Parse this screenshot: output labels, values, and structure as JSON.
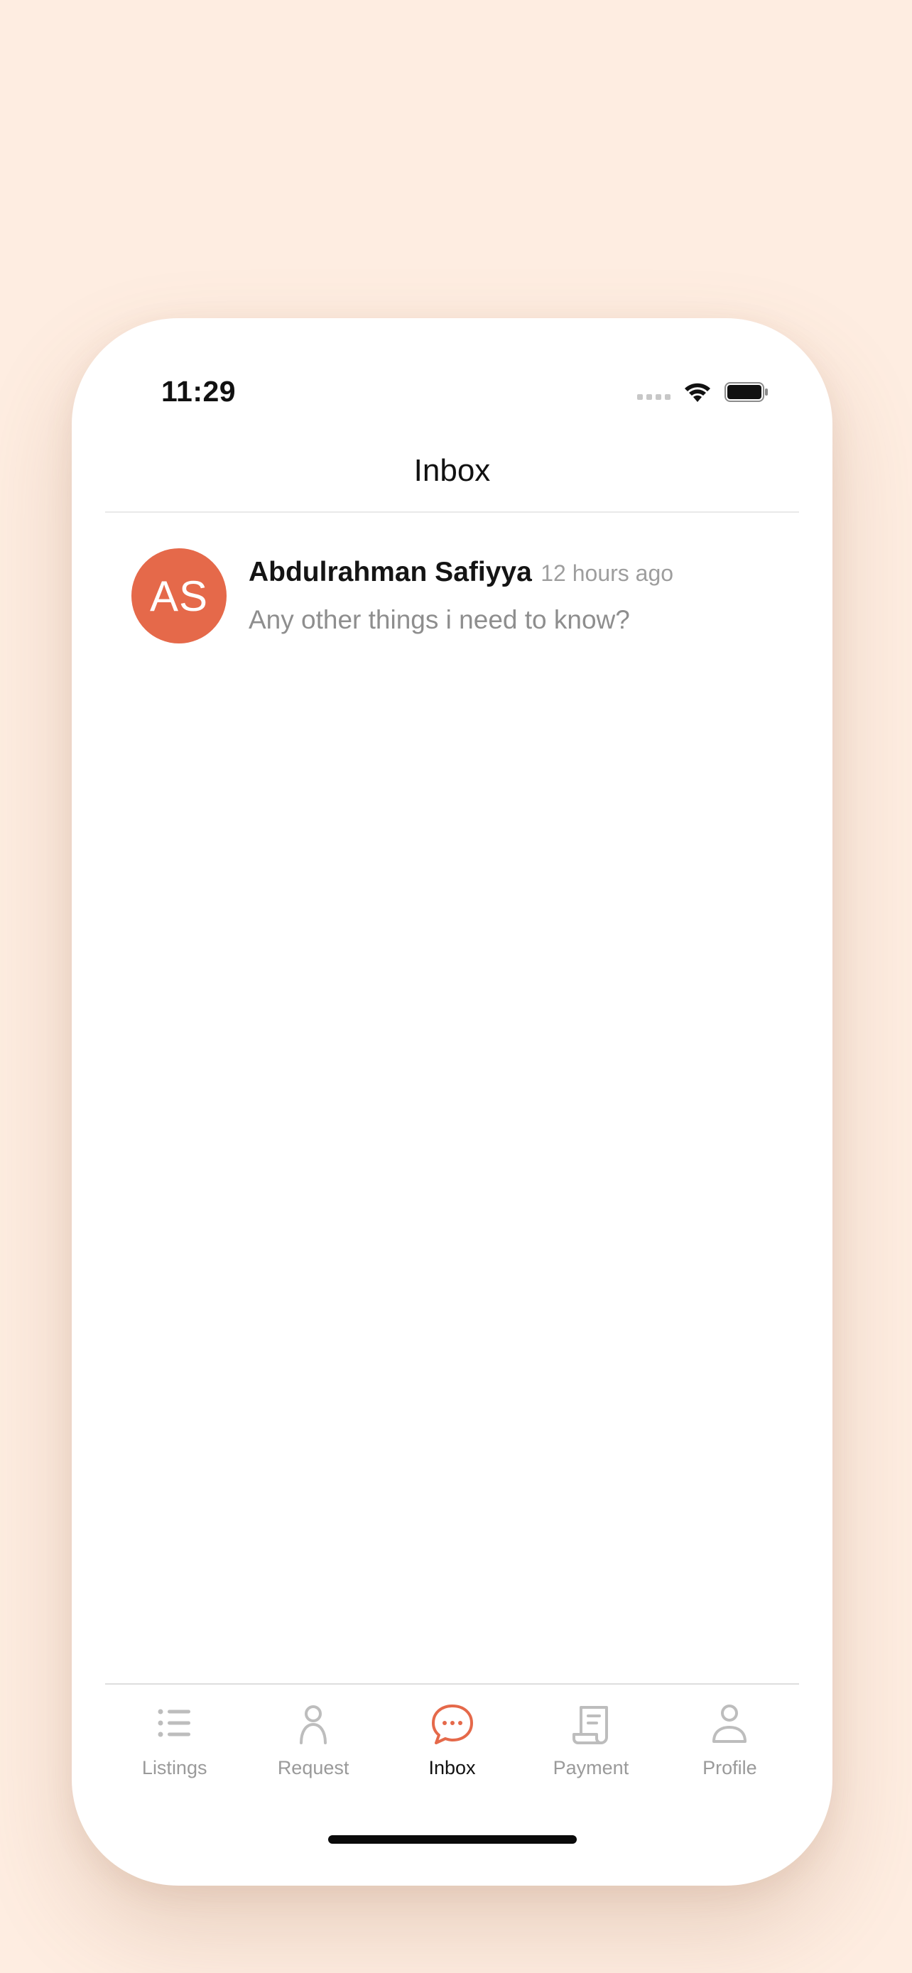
{
  "status_bar": {
    "time": "11:29"
  },
  "header": {
    "title": "Inbox"
  },
  "messages": [
    {
      "initials": "AS",
      "sender": "Abdulrahman Safiyya",
      "time": "12 hours ago",
      "preview": "Any other things i need to know?",
      "avatar_color": "#E5694A"
    }
  ],
  "tab_bar": {
    "active": "Inbox",
    "items": [
      {
        "label": "Listings",
        "icon": "list-icon"
      },
      {
        "label": "Request",
        "icon": "person-icon"
      },
      {
        "label": "Inbox",
        "icon": "chat-bubble-icon"
      },
      {
        "label": "Payment",
        "icon": "receipt-icon"
      },
      {
        "label": "Profile",
        "icon": "user-icon"
      }
    ]
  },
  "colors": {
    "background": "#FEEDE1",
    "accent": "#E5694A",
    "inactive_tab": "#9a9a9a"
  }
}
